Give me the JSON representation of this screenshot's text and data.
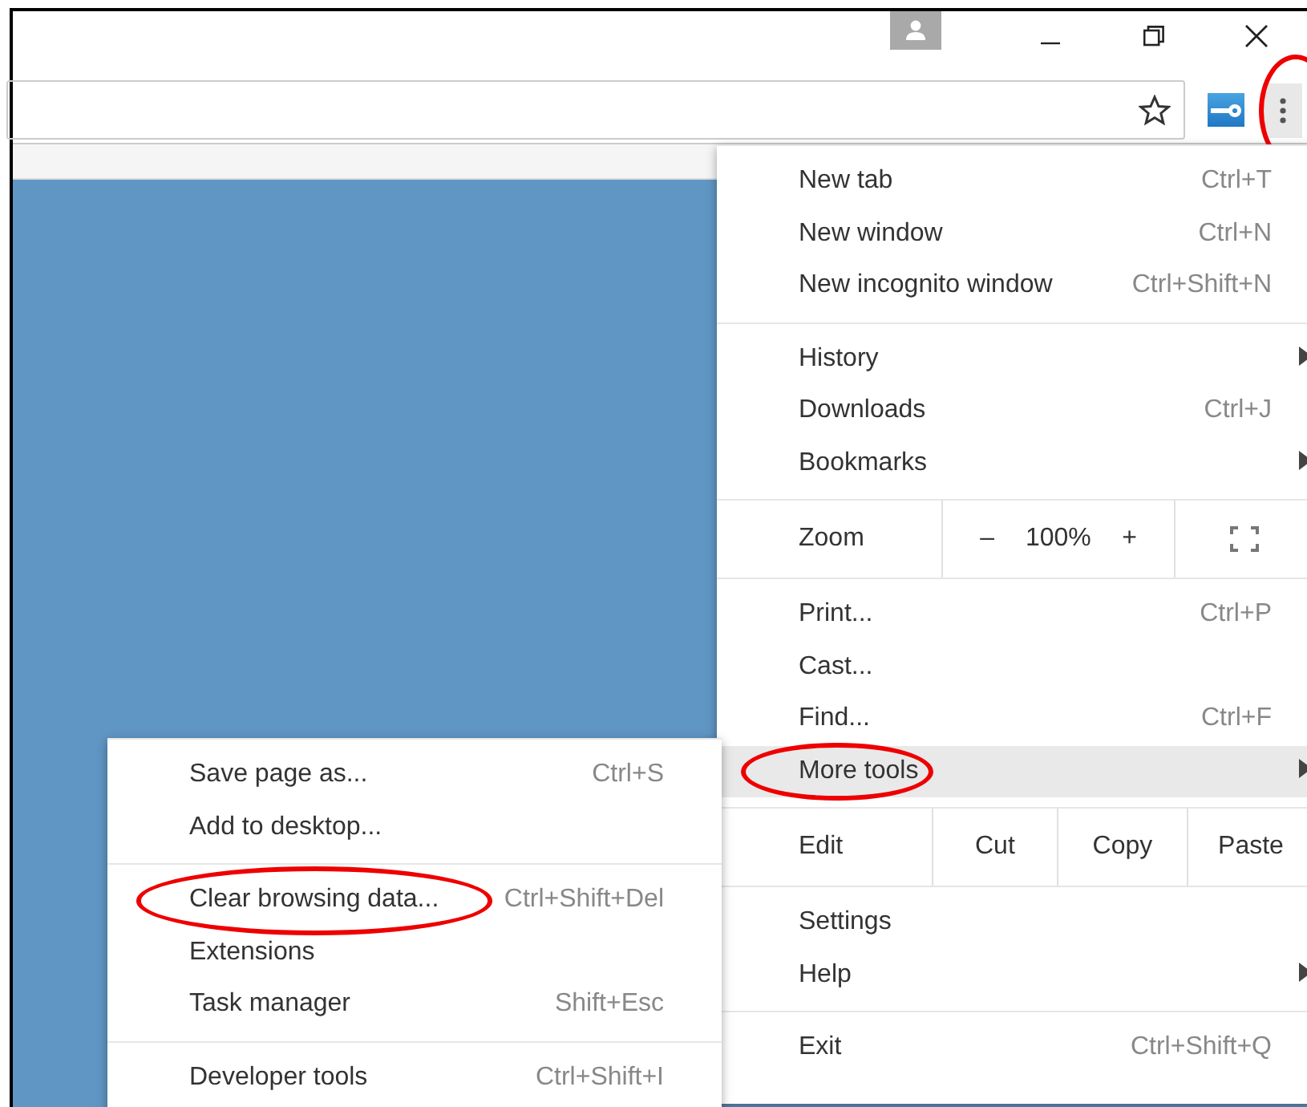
{
  "toolbar": {
    "menu_button": {
      "circled": true
    }
  },
  "main_menu": {
    "sections": [
      {
        "items": [
          {
            "kind": "item",
            "label": "New tab",
            "shortcut": "Ctrl+T",
            "submenu": false,
            "selected": false,
            "circled": false
          },
          {
            "kind": "item",
            "label": "New window",
            "shortcut": "Ctrl+N",
            "submenu": false,
            "selected": false,
            "circled": false
          },
          {
            "kind": "item",
            "label": "New incognito window",
            "shortcut": "Ctrl+Shift+N",
            "submenu": false,
            "selected": false,
            "circled": false
          }
        ]
      },
      {
        "items": [
          {
            "kind": "item",
            "label": "History",
            "submenu": true,
            "selected": false,
            "circled": false
          },
          {
            "kind": "item",
            "label": "Downloads",
            "shortcut": "Ctrl+J",
            "submenu": false,
            "selected": false,
            "circled": false
          },
          {
            "kind": "item",
            "label": "Bookmarks",
            "submenu": true,
            "selected": false,
            "circled": false
          }
        ]
      },
      {
        "items": [
          {
            "kind": "zoom",
            "label": "Zoom",
            "minus": "–",
            "value": "100%",
            "plus": "+"
          }
        ]
      },
      {
        "items": [
          {
            "kind": "item",
            "label": "Print...",
            "shortcut": "Ctrl+P",
            "submenu": false,
            "selected": false,
            "circled": false
          },
          {
            "kind": "item",
            "label": "Cast...",
            "submenu": false,
            "selected": false,
            "circled": false
          },
          {
            "kind": "item",
            "label": "Find...",
            "shortcut": "Ctrl+F",
            "submenu": false,
            "selected": false,
            "circled": false
          },
          {
            "kind": "item",
            "label": "More tools",
            "submenu": true,
            "selected": true,
            "circled": true
          }
        ]
      },
      {
        "items": [
          {
            "kind": "edit",
            "label": "Edit",
            "buttons": [
              "Cut",
              "Copy",
              "Paste"
            ]
          }
        ]
      },
      {
        "items": [
          {
            "kind": "item",
            "label": "Settings",
            "submenu": false,
            "selected": false,
            "circled": false
          },
          {
            "kind": "item",
            "label": "Help",
            "submenu": true,
            "selected": false,
            "circled": false
          }
        ]
      },
      {
        "items": [
          {
            "kind": "item",
            "label": "Exit",
            "shortcut": "Ctrl+Shift+Q",
            "submenu": false,
            "selected": false,
            "circled": false
          }
        ]
      }
    ]
  },
  "more_tools_menu": {
    "sections": [
      {
        "items": [
          {
            "kind": "item",
            "label": "Save page as...",
            "shortcut": "Ctrl+S",
            "submenu": false,
            "selected": false,
            "circled": false
          },
          {
            "kind": "item",
            "label": "Add to desktop...",
            "submenu": false,
            "selected": false,
            "circled": false
          }
        ]
      },
      {
        "items": [
          {
            "kind": "item",
            "label": "Clear browsing data...",
            "shortcut": "Ctrl+Shift+Del",
            "submenu": false,
            "selected": false,
            "circled": true
          },
          {
            "kind": "item",
            "label": "Extensions",
            "submenu": false,
            "selected": false,
            "circled": false
          },
          {
            "kind": "item",
            "label": "Task manager",
            "shortcut": "Shift+Esc",
            "submenu": false,
            "selected": false,
            "circled": false
          }
        ]
      },
      {
        "items": [
          {
            "kind": "item",
            "label": "Developer tools",
            "shortcut": "Ctrl+Shift+I",
            "submenu": false,
            "selected": false,
            "circled": false
          }
        ]
      }
    ]
  }
}
